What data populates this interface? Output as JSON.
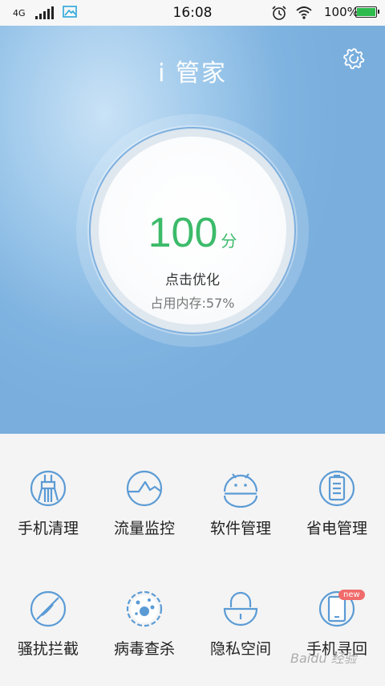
{
  "status_bar": {
    "network": "4G",
    "time": "16:08",
    "battery_percent": "100%",
    "battery_level": 1.0,
    "battery_color": "#2dbb4e"
  },
  "header": {
    "title": "i 管家",
    "settings_icon": "gear-icon"
  },
  "score_panel": {
    "score": "100",
    "unit": "分",
    "action": "点击优化",
    "memory": "占用内存:57%",
    "score_color": "#3cbb6a"
  },
  "tools": [
    {
      "label": "手机清理",
      "icon": "broom-icon"
    },
    {
      "label": "流量监控",
      "icon": "traffic-monitor-icon"
    },
    {
      "label": "软件管理",
      "icon": "android-icon"
    },
    {
      "label": "省电管理",
      "icon": "battery-saver-icon"
    },
    {
      "label": "骚扰拦截",
      "icon": "block-icon"
    },
    {
      "label": "病毒查杀",
      "icon": "virus-icon"
    },
    {
      "label": "隐私空间",
      "icon": "lock-icon"
    },
    {
      "label": "手机寻回",
      "icon": "phone-finder-icon",
      "badge": "new"
    }
  ],
  "watermark": "Baidu 经验",
  "accent_color": "#7fb0de"
}
